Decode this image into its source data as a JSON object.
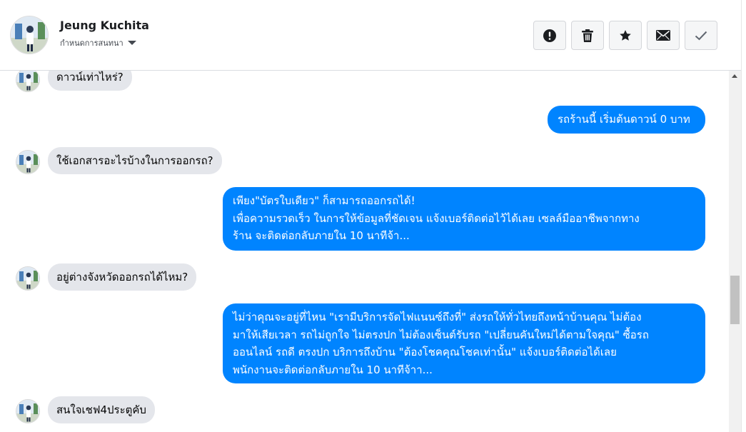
{
  "header": {
    "contact_name": "Jeung Kuchita",
    "subtitle": "กำหนดการสนทนา"
  },
  "actions": [
    {
      "icon": "alert-icon"
    },
    {
      "icon": "trash-icon"
    },
    {
      "icon": "star-icon"
    },
    {
      "icon": "mail-icon"
    },
    {
      "icon": "check-icon"
    }
  ],
  "messages": [
    {
      "from": "contact",
      "text": "ดาวน์เท่าไหร่?"
    },
    {
      "from": "page",
      "text": "รถร้านนี้ เริ่มต้นดาวน์ 0 บาท"
    },
    {
      "from": "contact",
      "text": "ใช้เอกสารอะไรบ้างในการออกรถ?"
    },
    {
      "from": "page",
      "text": "เพียง\"บัตรใบเดียว\" ก็สามารถออกรถได้!\nเพื่อความรวดเร็ว ในการให้ข้อมูลที่ชัดเจน แจ้งเบอร์ติดต่อไว้ได้เลย เซลล์มืออาชีพจากทาง\nร้าน จะติดต่อกลับภายใน 10 นาทีจ้า..."
    },
    {
      "from": "contact",
      "text": "อยู่ต่างจังหวัดออกรถได้ไหม?"
    },
    {
      "from": "page",
      "text": "ไม่ว่าคุณจะอยู่ที่ไหน \"เรามีบริการจัดไฟแนนซ์ถึงที่\"  ส่งรถให้ทั่วไทยถึงหน้าบ้านคุณ ไม่ต้อง\nมาให้เสียเวลา รถไม่ถูกใจ ไม่ตรงปก ไม่ต้องเซ็นต์รับรถ \"เปลี่ยนคันใหม่ได้ตามใจคุณ\" ซื้อรถ\nออนไลน์ รถดี ตรงปก บริการถึงบ้าน \"ต้องโชคคุณโชคเท่านั้น\" แจ้งเบอร์ติดต่อได้เลย\nพนักงานจะติดต่อกลับภายใน 10 นาทีจ้าา..."
    },
    {
      "from": "contact",
      "text": "สนใจเชฟ4ประตูคับ"
    }
  ],
  "colors": {
    "outgoing_bubble": "#0084ff",
    "incoming_bubble": "#e4e6eb"
  }
}
